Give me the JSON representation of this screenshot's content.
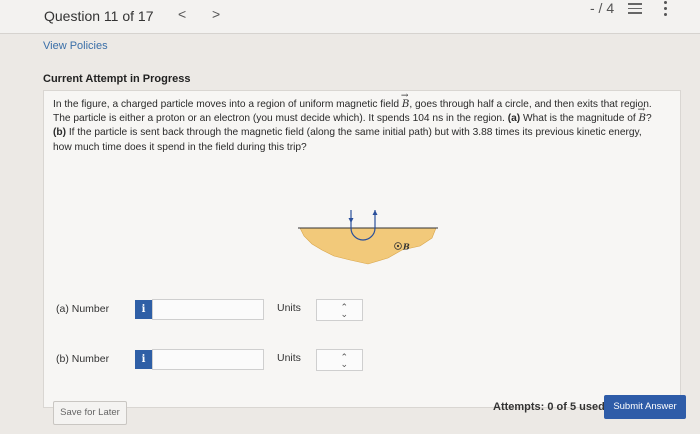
{
  "header": {
    "question_label": "Question 11 of 17",
    "prev_symbol": "<",
    "next_symbol": ">",
    "score": "- / 4"
  },
  "links": {
    "view_policies": "View Policies"
  },
  "attempt_heading": "Current Attempt in Progress",
  "question": {
    "line1_pre": "In the figure, a charged particle moves into a region of uniform magnetic field ",
    "line1_post": ", goes through half a circle, and then exits that region.",
    "line2_pre": "The particle is either a proton or an electron (you must decide which). It spends 104 ns in the region. ",
    "part_a_tag": "(a)",
    "line2_mid": " What is the magnitude of ",
    "line2_post": "?",
    "part_b_tag": "(b)",
    "line3": " If the particle is sent back through the magnetic field (along the same initial path) but with 3.88 times its previous kinetic energy,",
    "line4": "how much time does it spend in the field during this trip?",
    "vector_symbol": "B"
  },
  "figure": {
    "field_label": "B",
    "field_color": "#f2c97a",
    "path_color": "#2a4f9b"
  },
  "part_a": {
    "label": "(a)   Number",
    "info": "i",
    "value": "",
    "units_label": "Units",
    "units_value": ""
  },
  "part_b": {
    "label": "(b)   Number",
    "info": "i",
    "value": "",
    "units_label": "Units",
    "units_value": ""
  },
  "footer": {
    "save_label": "Save for Later",
    "attempts_text": "Attempts: 0 of 5 used",
    "submit_label": "Submit Answer"
  }
}
